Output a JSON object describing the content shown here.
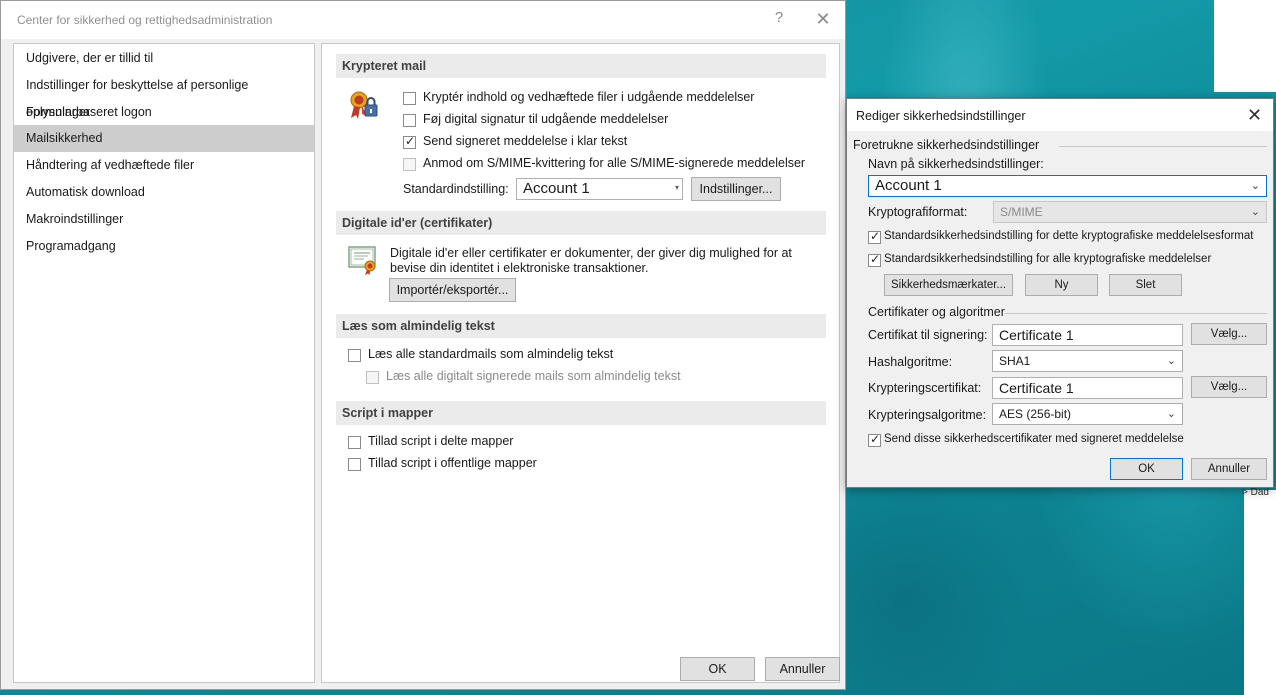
{
  "trust_center": {
    "title": "Center for sikkerhed og rettighedsadministration",
    "help_glyph": "?",
    "close_glyph": "✕",
    "nav": [
      "Udgivere, der er tillid til",
      "Indstillinger for beskyttelse af personlige oplysninger",
      "Formularbaseret logon",
      "Mailsikkerhed",
      "Håndtering af vedhæftede filer",
      "Automatisk download",
      "Makroindstillinger",
      "Programadgang"
    ],
    "selected_nav": "Mailsikkerhed",
    "encrypted_mail": {
      "header": "Krypteret mail",
      "options": [
        {
          "label": "Kryptér indhold og vedhæftede filer i udgående meddelelser",
          "checked": false
        },
        {
          "label": "Føj digital signatur til udgående meddelelser",
          "checked": false
        },
        {
          "label": "Send signeret meddelelse i klar tekst",
          "checked": true
        },
        {
          "label": "Anmod om S/MIME-kvittering for alle S/MIME-signerede meddelelser",
          "checked": false
        }
      ],
      "default_setting_label": "Standardindstilling:",
      "default_setting_value": "Account 1",
      "settings_button": "Indstillinger..."
    },
    "digital_ids": {
      "header": "Digitale id'er (certifikater)",
      "description": "Digitale id'er eller certifikater er dokumenter, der giver dig mulighed for at bevise din identitet i elektroniske transaktioner.",
      "import_export_button": "Importér/eksportér..."
    },
    "plain_text": {
      "header": "Læs som almindelig tekst",
      "read_all_label": "Læs alle standardmails som almindelig tekst",
      "read_signed_label": "Læs alle digitalt signerede mails som almindelig tekst"
    },
    "script_folders": {
      "header": "Script i mapper",
      "shared_label": "Tillad script i delte mapper",
      "public_label": "Tillad script i offentlige mapper"
    },
    "ok_button": "OK",
    "cancel_button": "Annuller"
  },
  "edit_security": {
    "title": "Rediger sikkerhedsindstillinger",
    "close_glyph": "✕",
    "preferred_group": "Foretrukne sikkerhedsindstillinger",
    "name_label": "Navn på sikkerhedsindstillinger:",
    "name_value": "Account 1",
    "crypto_format_label": "Kryptografiformat:",
    "crypto_format_value": "S/MIME",
    "default_for_format_label": "Standardsikkerhedsindstilling for dette kryptografiske meddelelsesformat",
    "default_for_format_checked": true,
    "default_for_all_label": "Standardsikkerhedsindstilling for alle kryptografiske meddelelser",
    "default_for_all_checked": true,
    "security_labels_button": "Sikkerhedsmærkater...",
    "new_button": "Ny",
    "delete_button": "Slet",
    "certs_group": "Certifikater og algoritmer",
    "signing_cert_label": "Certifikat til signering:",
    "signing_cert_value": "Certificate 1",
    "choose_button": "Vælg...",
    "hash_label": "Hashalgoritme:",
    "hash_value": "SHA1",
    "encryption_cert_label": "Krypteringscertifikat:",
    "encryption_cert_value": "Certificate 1",
    "encryption_alg_label": "Krypteringsalgoritme:",
    "encryption_alg_value": "AES (256-bit)",
    "send_certs_label": "Send disse sikkerhedscertifikater med signeret meddelelse",
    "send_certs_checked": true,
    "ok_button": "OK",
    "cancel_button": "Annuller"
  },
  "background": {
    "side_text": "> Dad"
  },
  "colors": {
    "selected_nav": "#cdcdcd",
    "focus_border": "#0078d7",
    "section_header": "#ebebeb",
    "desktop_teal": "#139aa8"
  }
}
